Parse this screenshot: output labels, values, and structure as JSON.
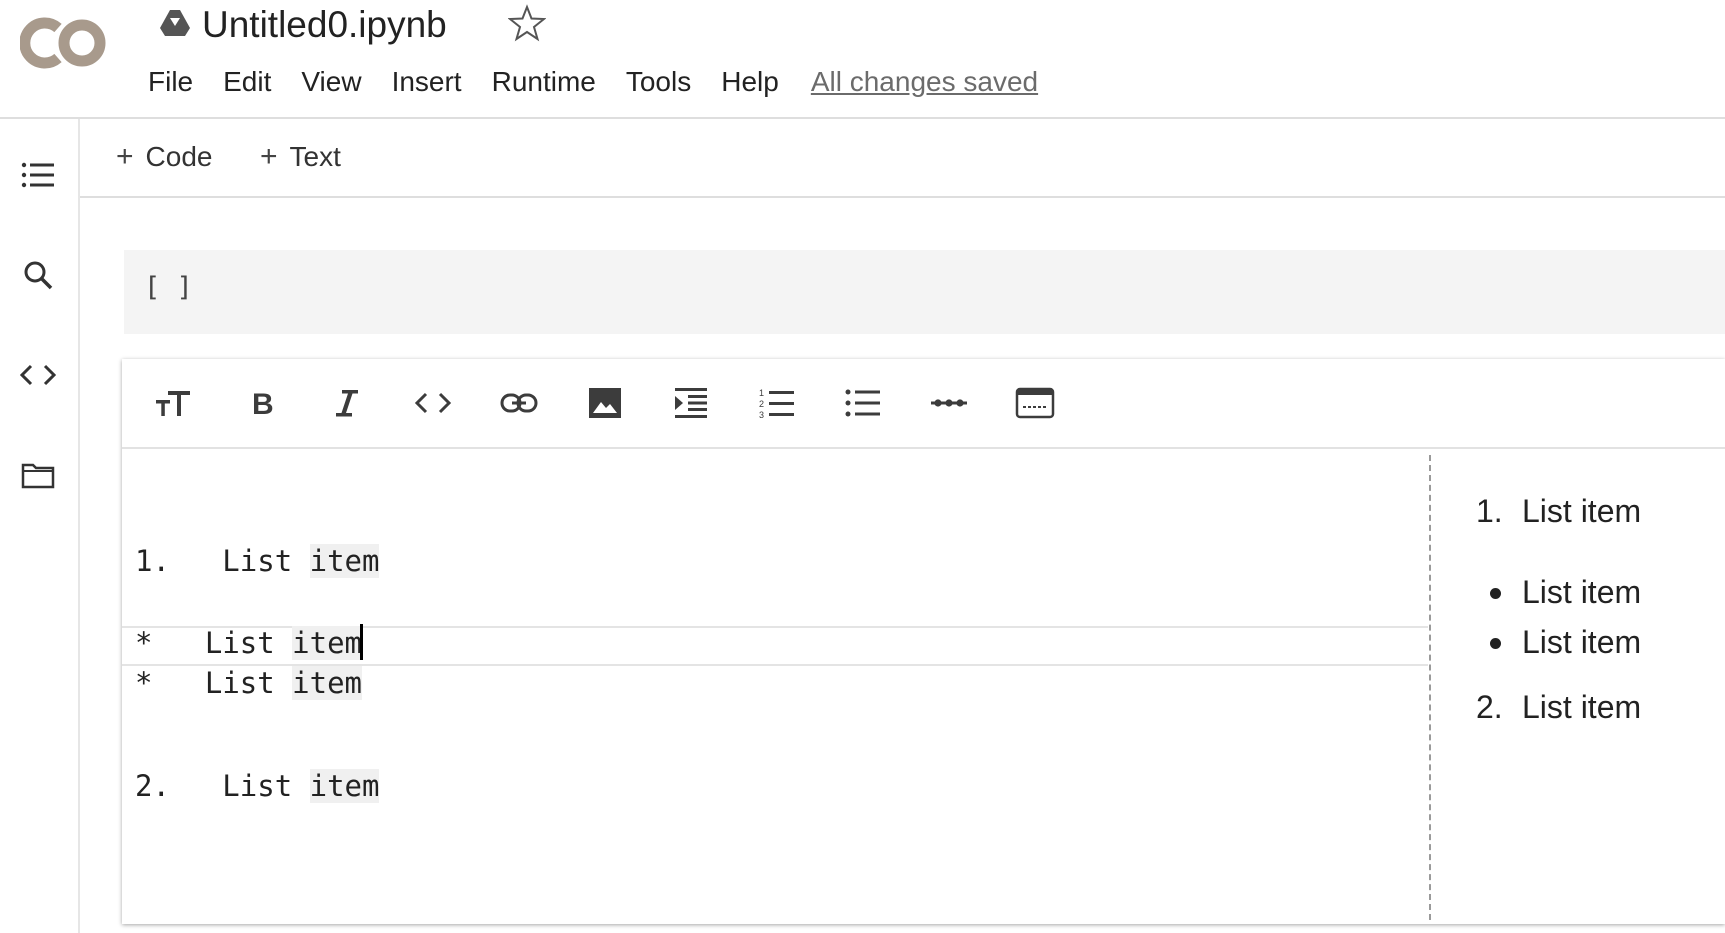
{
  "app": {
    "logo_text": "CO",
    "notebook_title": "Untitled0.ipynb",
    "icons": {
      "drive": "drive-icon",
      "star": "star-icon"
    }
  },
  "menu": {
    "items": [
      "File",
      "Edit",
      "View",
      "Insert",
      "Runtime",
      "Tools",
      "Help"
    ],
    "save_status": "All changes saved"
  },
  "sidebar": {
    "icons": [
      "table-of-contents-icon",
      "search-icon",
      "code-snippets-icon",
      "files-folder-icon"
    ]
  },
  "toolbar": {
    "add_code_label": "Code",
    "add_text_label": "Text",
    "plus": "+"
  },
  "code_cell": {
    "run_indicator": "[ ]"
  },
  "text_cell": {
    "format_buttons": [
      "heading-icon",
      "bold-icon",
      "italic-icon",
      "code-icon",
      "link-icon",
      "image-icon",
      "indent-icon",
      "numbered-list-icon",
      "bulleted-list-icon",
      "horizontal-rule-icon",
      "emoji-icon"
    ],
    "editor_lines": [
      {
        "marker": "1.",
        "pre": "  List ",
        "word": "item"
      },
      {
        "marker": "*",
        "pre": "  List ",
        "word": "item"
      },
      {
        "marker": "*",
        "pre": "  List ",
        "word": "item"
      },
      {
        "marker": "2.",
        "pre": "  List ",
        "word": "item"
      }
    ],
    "preview": [
      {
        "marker": "1.",
        "text": "List item"
      },
      {
        "marker": "•",
        "text": "List item"
      },
      {
        "marker": "•",
        "text": "List item"
      },
      {
        "marker": "2.",
        "text": "List item"
      }
    ]
  },
  "colors": {
    "logo": "#a89a8c",
    "border": "#dedede",
    "code_cell_bg": "#f4f4f4",
    "status_text": "#6b6b6b"
  }
}
